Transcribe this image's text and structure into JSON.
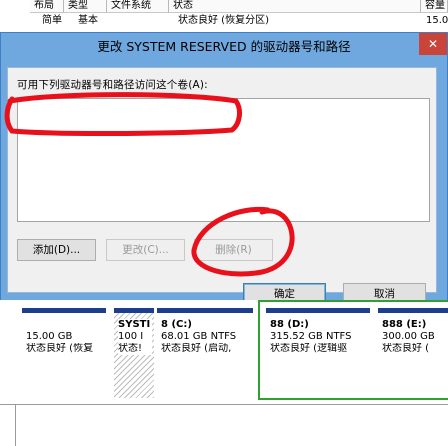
{
  "background_table": {
    "headers": [
      "布局",
      "类型",
      "文件系统",
      "状态",
      "容量"
    ],
    "row": [
      "简单",
      "基本",
      "",
      "状态良好 (恢复分区)",
      "15.0"
    ]
  },
  "dialog": {
    "title": "更改 SYSTEM RESERVED 的驱动器号和路径",
    "close_label": "✕",
    "list_label": "可用下列驱动器号和路径访问这个卷(A):",
    "buttons": {
      "add": "添加(D)...",
      "change": "更改(C)...",
      "remove": "删除(R)",
      "ok": "确定",
      "cancel": "取消"
    }
  },
  "disk_map": {
    "partitions": [
      {
        "name": "",
        "size": "15.00 GB",
        "status": "状态良好 (恢复"
      },
      {
        "name": "SYSTI",
        "size": "100 I",
        "status": "状态!"
      },
      {
        "name": "8  (C:)",
        "size": "68.01 GB NTFS",
        "status": "状态良好 (启动,"
      },
      {
        "name": "88  (D:)",
        "size": "315.52 GB NTFS",
        "status": "状态良好 (逻辑驱"
      },
      {
        "name": "888  (E:)",
        "size": "300.00 GB",
        "status": "状态良好 ("
      }
    ]
  },
  "colors": {
    "dialog_frame": "#6fa7df",
    "annotation": "#e8101b",
    "partition_header": "#1c3e8d",
    "selected_partition": "#2fa12f"
  }
}
